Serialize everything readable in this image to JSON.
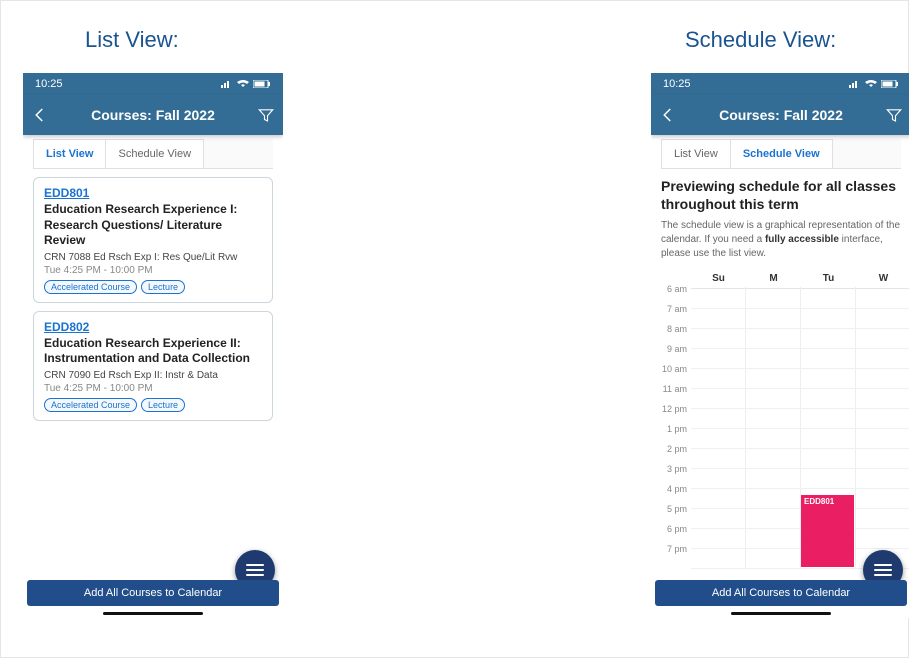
{
  "captions": {
    "left": "List View:",
    "right": "Schedule View:"
  },
  "status": {
    "time": "10:25"
  },
  "nav": {
    "title": "Courses: Fall 2022"
  },
  "tabs": {
    "list": "List View",
    "schedule": "Schedule View"
  },
  "courses": [
    {
      "code": "EDD801",
      "title": "Education Research Experience I: Research Questions/ Literature Review",
      "sub": "CRN 7088 Ed Rsch Exp I: Res Que/Lit Rvw",
      "time": "Tue 4:25 PM - 10:00 PM",
      "badges": [
        "Accelerated Course",
        "Lecture"
      ]
    },
    {
      "code": "EDD802",
      "title": "Education Research Experience II: Instrumentation and Data Collection",
      "sub": "CRN 7090 Ed Rsch Exp II: Instr & Data",
      "time": "Tue 4:25 PM - 10:00 PM",
      "badges": [
        "Accelerated Course",
        "Lecture"
      ]
    }
  ],
  "schedule": {
    "heading": "Previewing schedule for all classes throughout this term",
    "note_pre": "The schedule view is a graphical representation of the calendar. If you need a ",
    "note_bold": "fully accessible",
    "note_post": " interface, please use the list view.",
    "days": [
      "Su",
      "M",
      "Tu",
      "W"
    ],
    "hours": [
      "6 am",
      "7 am",
      "8 am",
      "9 am",
      "10 am",
      "11 am",
      "12 pm",
      "1 pm",
      "2 pm",
      "3 pm",
      "4 pm",
      "5 pm",
      "6 pm",
      "7 pm"
    ],
    "event": {
      "label": "EDD801",
      "day_index": 2,
      "start_hour_index": 10.4,
      "end_hour_index": 14
    }
  },
  "buttons": {
    "add_all": "Add All Courses to Calendar"
  }
}
